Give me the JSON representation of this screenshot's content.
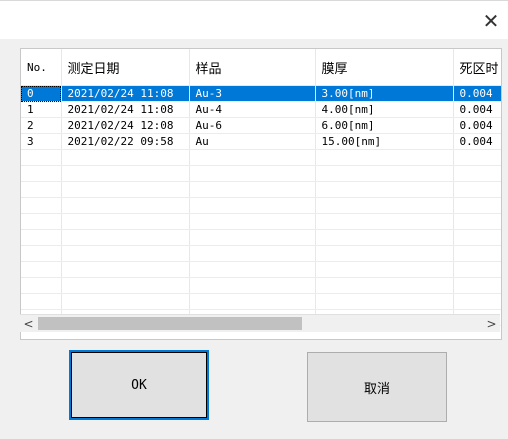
{
  "window": {
    "close_glyph": "✕"
  },
  "table": {
    "columns": [
      "No.",
      "测定日期",
      "样品",
      "膜厚",
      "死区时"
    ],
    "rows": [
      [
        "0",
        "2021/02/24 11:08",
        "Au-3",
        "3.00[nm]",
        "0.004"
      ],
      [
        "1",
        "2021/02/24 11:08",
        "Au-4",
        "4.00[nm]",
        "0.004"
      ],
      [
        "2",
        "2021/02/24 12:08",
        "Au-6",
        "6.00[nm]",
        "0.004"
      ],
      [
        "3",
        "2021/02/22 09:58",
        "Au",
        "15.00[nm]",
        "0.004"
      ]
    ],
    "selected_row": 0,
    "scroll_left": "<",
    "scroll_right": ">"
  },
  "buttons": {
    "ok": "OK",
    "cancel": "取消"
  }
}
